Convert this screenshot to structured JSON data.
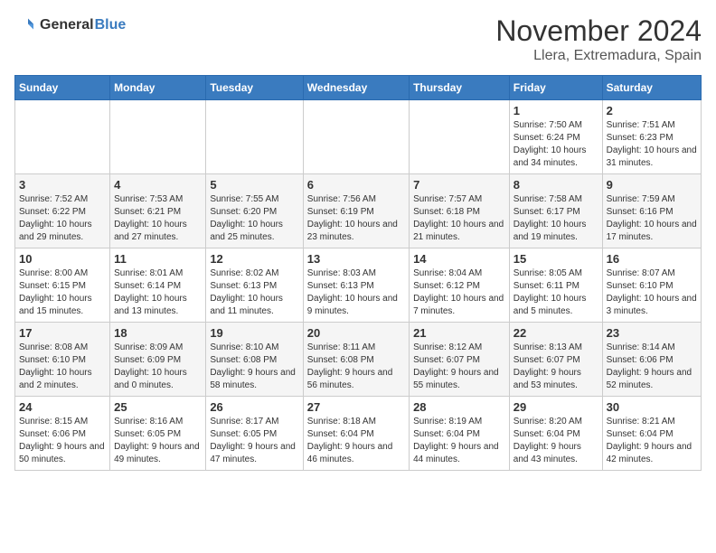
{
  "header": {
    "logo_general": "General",
    "logo_blue": "Blue",
    "title": "November 2024",
    "subtitle": "Llera, Extremadura, Spain"
  },
  "calendar": {
    "days_of_week": [
      "Sunday",
      "Monday",
      "Tuesday",
      "Wednesday",
      "Thursday",
      "Friday",
      "Saturday"
    ],
    "weeks": [
      [
        {
          "day": "",
          "info": ""
        },
        {
          "day": "",
          "info": ""
        },
        {
          "day": "",
          "info": ""
        },
        {
          "day": "",
          "info": ""
        },
        {
          "day": "",
          "info": ""
        },
        {
          "day": "1",
          "info": "Sunrise: 7:50 AM\nSunset: 6:24 PM\nDaylight: 10 hours and 34 minutes."
        },
        {
          "day": "2",
          "info": "Sunrise: 7:51 AM\nSunset: 6:23 PM\nDaylight: 10 hours and 31 minutes."
        }
      ],
      [
        {
          "day": "3",
          "info": "Sunrise: 7:52 AM\nSunset: 6:22 PM\nDaylight: 10 hours and 29 minutes."
        },
        {
          "day": "4",
          "info": "Sunrise: 7:53 AM\nSunset: 6:21 PM\nDaylight: 10 hours and 27 minutes."
        },
        {
          "day": "5",
          "info": "Sunrise: 7:55 AM\nSunset: 6:20 PM\nDaylight: 10 hours and 25 minutes."
        },
        {
          "day": "6",
          "info": "Sunrise: 7:56 AM\nSunset: 6:19 PM\nDaylight: 10 hours and 23 minutes."
        },
        {
          "day": "7",
          "info": "Sunrise: 7:57 AM\nSunset: 6:18 PM\nDaylight: 10 hours and 21 minutes."
        },
        {
          "day": "8",
          "info": "Sunrise: 7:58 AM\nSunset: 6:17 PM\nDaylight: 10 hours and 19 minutes."
        },
        {
          "day": "9",
          "info": "Sunrise: 7:59 AM\nSunset: 6:16 PM\nDaylight: 10 hours and 17 minutes."
        }
      ],
      [
        {
          "day": "10",
          "info": "Sunrise: 8:00 AM\nSunset: 6:15 PM\nDaylight: 10 hours and 15 minutes."
        },
        {
          "day": "11",
          "info": "Sunrise: 8:01 AM\nSunset: 6:14 PM\nDaylight: 10 hours and 13 minutes."
        },
        {
          "day": "12",
          "info": "Sunrise: 8:02 AM\nSunset: 6:13 PM\nDaylight: 10 hours and 11 minutes."
        },
        {
          "day": "13",
          "info": "Sunrise: 8:03 AM\nSunset: 6:13 PM\nDaylight: 10 hours and 9 minutes."
        },
        {
          "day": "14",
          "info": "Sunrise: 8:04 AM\nSunset: 6:12 PM\nDaylight: 10 hours and 7 minutes."
        },
        {
          "day": "15",
          "info": "Sunrise: 8:05 AM\nSunset: 6:11 PM\nDaylight: 10 hours and 5 minutes."
        },
        {
          "day": "16",
          "info": "Sunrise: 8:07 AM\nSunset: 6:10 PM\nDaylight: 10 hours and 3 minutes."
        }
      ],
      [
        {
          "day": "17",
          "info": "Sunrise: 8:08 AM\nSunset: 6:10 PM\nDaylight: 10 hours and 2 minutes."
        },
        {
          "day": "18",
          "info": "Sunrise: 8:09 AM\nSunset: 6:09 PM\nDaylight: 10 hours and 0 minutes."
        },
        {
          "day": "19",
          "info": "Sunrise: 8:10 AM\nSunset: 6:08 PM\nDaylight: 9 hours and 58 minutes."
        },
        {
          "day": "20",
          "info": "Sunrise: 8:11 AM\nSunset: 6:08 PM\nDaylight: 9 hours and 56 minutes."
        },
        {
          "day": "21",
          "info": "Sunrise: 8:12 AM\nSunset: 6:07 PM\nDaylight: 9 hours and 55 minutes."
        },
        {
          "day": "22",
          "info": "Sunrise: 8:13 AM\nSunset: 6:07 PM\nDaylight: 9 hours and 53 minutes."
        },
        {
          "day": "23",
          "info": "Sunrise: 8:14 AM\nSunset: 6:06 PM\nDaylight: 9 hours and 52 minutes."
        }
      ],
      [
        {
          "day": "24",
          "info": "Sunrise: 8:15 AM\nSunset: 6:06 PM\nDaylight: 9 hours and 50 minutes."
        },
        {
          "day": "25",
          "info": "Sunrise: 8:16 AM\nSunset: 6:05 PM\nDaylight: 9 hours and 49 minutes."
        },
        {
          "day": "26",
          "info": "Sunrise: 8:17 AM\nSunset: 6:05 PM\nDaylight: 9 hours and 47 minutes."
        },
        {
          "day": "27",
          "info": "Sunrise: 8:18 AM\nSunset: 6:04 PM\nDaylight: 9 hours and 46 minutes."
        },
        {
          "day": "28",
          "info": "Sunrise: 8:19 AM\nSunset: 6:04 PM\nDaylight: 9 hours and 44 minutes."
        },
        {
          "day": "29",
          "info": "Sunrise: 8:20 AM\nSunset: 6:04 PM\nDaylight: 9 hours and 43 minutes."
        },
        {
          "day": "30",
          "info": "Sunrise: 8:21 AM\nSunset: 6:04 PM\nDaylight: 9 hours and 42 minutes."
        }
      ]
    ]
  }
}
